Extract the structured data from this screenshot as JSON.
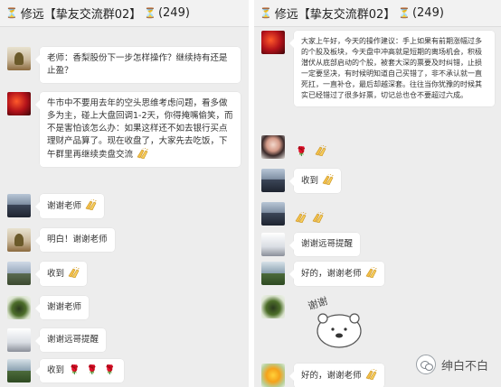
{
  "left_chat": {
    "title": "修远【挚友交流群02】",
    "member_count": "(249)",
    "messages": [
      {
        "text": "老师：香梨股份下一步怎样操作？继续持有还是止盈？"
      },
      {
        "text": "牛市中不要用去年的空头思维考虑问题，看多做多为主，碰上大盘回调1-2天，你得掩嘴偷笑，而不是害怕该怎么办：如果这样还不如去银行买点理财产品算了。现在收盘了，大家先去吃饭，下午群里再继续卖盘交流"
      },
      {
        "text": "谢谢老师"
      },
      {
        "text": "明白！谢谢老师"
      },
      {
        "text": "收到"
      },
      {
        "text": "谢谢老师"
      },
      {
        "text": "谢谢远哥提醒"
      },
      {
        "text": "收到"
      }
    ]
  },
  "right_chat": {
    "title": "修远【挚友交流群02】",
    "member_count": "(249)",
    "messages": [
      {
        "text": "大家上午好，今天的操作建议：手上如果有前期涨幅过多的个股及板块，今天盘中冲高就是短期的离场机会，积极潜伏从底部启动的个股，被套大深的票要及时纠错，止损一定要坚决，有时候明知道自己买错了，非不承认就一直死扛，一直补仓，最后却越深套。往往当你犹豫的时候其实已经错过了很多好票，切记总也仓不要超过六成。"
      },
      {
        "text": "收到"
      },
      {
        "text": "谢谢远哥提醒"
      },
      {
        "text": "好的，谢谢老师"
      },
      {
        "text": "好的，谢谢老师"
      }
    ],
    "sticker_text": "谢谢"
  },
  "watermark": {
    "label": "绅白不白"
  },
  "icons": {
    "hourglass": "hourglass-icon",
    "clap": "clapping-hands-icon",
    "rose": "rose-icon",
    "pray": "praying-hands-icon"
  },
  "colors": {
    "chat_bg": "#ededed",
    "bubble_bg": "#ffffff",
    "header_bg": "#f2f2f2"
  }
}
